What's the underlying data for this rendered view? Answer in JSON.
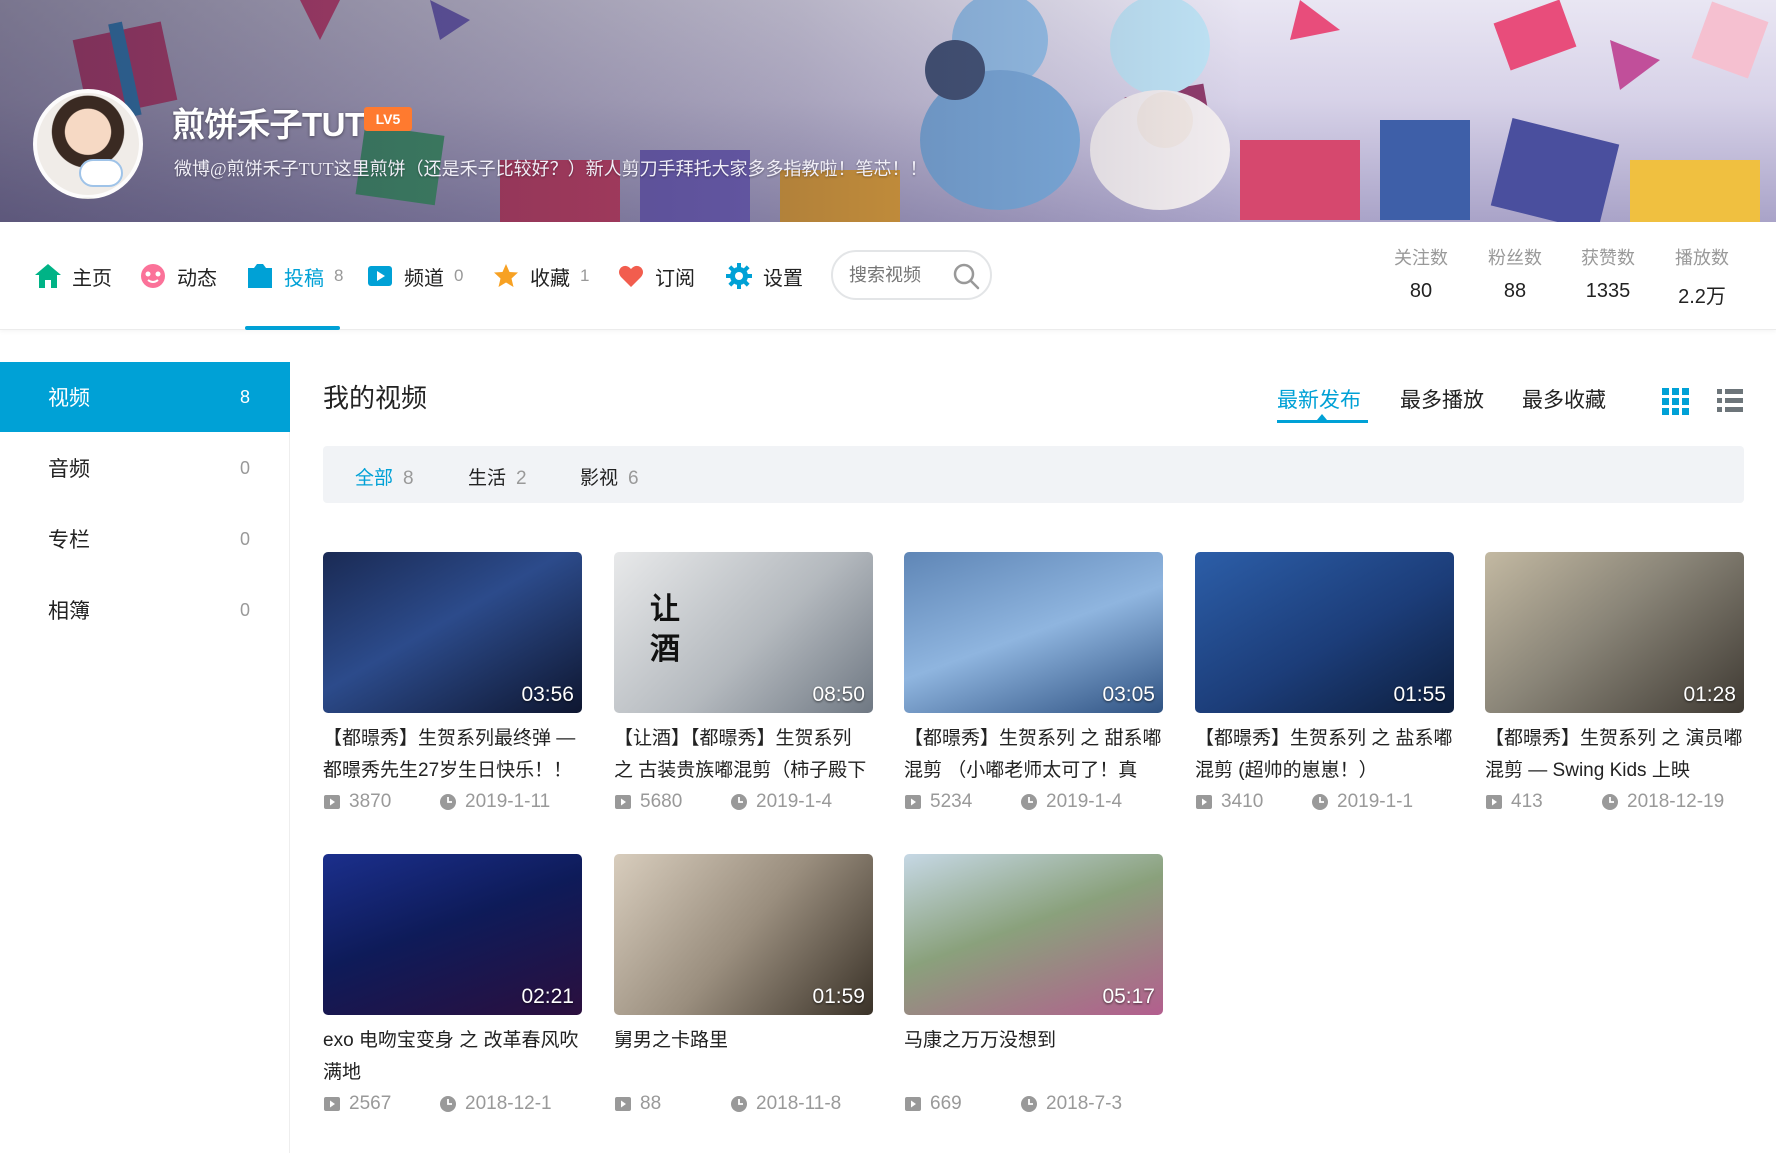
{
  "profile": {
    "username": "煎饼禾子TUT",
    "level": "LV5",
    "bio": "微博@煎饼禾子TUT这里煎饼（还是禾子比较好？）新人剪刀手拜托大家多多指教啦！笔芯！！"
  },
  "nav": {
    "items": [
      {
        "label": "主页",
        "count": "",
        "icon": "home-icon"
      },
      {
        "label": "动态",
        "count": "",
        "icon": "activity-icon"
      },
      {
        "label": "投稿",
        "count": "8",
        "icon": "upload-icon"
      },
      {
        "label": "频道",
        "count": "0",
        "icon": "channel-icon"
      },
      {
        "label": "收藏",
        "count": "1",
        "icon": "star-icon"
      },
      {
        "label": "订阅",
        "count": "",
        "icon": "heart-icon"
      },
      {
        "label": "设置",
        "count": "",
        "icon": "gear-icon"
      }
    ],
    "active_index": 2,
    "accent": "#00a1d6"
  },
  "search": {
    "placeholder": "搜索视频"
  },
  "stats": [
    {
      "label": "关注数",
      "value": "80"
    },
    {
      "label": "粉丝数",
      "value": "88"
    },
    {
      "label": "获赞数",
      "value": "1335"
    },
    {
      "label": "播放数",
      "value": "2.2万"
    }
  ],
  "sidebar": {
    "items": [
      {
        "label": "视频",
        "count": "8"
      },
      {
        "label": "音频",
        "count": "0"
      },
      {
        "label": "专栏",
        "count": "0"
      },
      {
        "label": "相簿",
        "count": "0"
      }
    ]
  },
  "main": {
    "title": "我的视频",
    "sort_tabs": [
      "最新发布",
      "最多播放",
      "最多收藏"
    ],
    "filters": [
      {
        "label": "全部",
        "count": "8"
      },
      {
        "label": "生活",
        "count": "2"
      },
      {
        "label": "影视",
        "count": "6"
      }
    ]
  },
  "videos": [
    {
      "title": "【都暻秀】生贺系列最终弹 — 都暻秀先生27岁生日快乐！！",
      "duration": "03:56",
      "plays": "3870",
      "date": "2019-1-11"
    },
    {
      "title": "【让酒】【都暻秀】生贺系列 之 古装贵族嘟混剪（柿子殿下",
      "duration": "08:50",
      "plays": "5680",
      "date": "2019-1-4",
      "thumb_text": "让\n酒"
    },
    {
      "title": "【都暻秀】生贺系列 之 甜系嘟混剪 （小嘟老师太可了！真",
      "duration": "03:05",
      "plays": "5234",
      "date": "2019-1-4"
    },
    {
      "title": "【都暻秀】生贺系列 之 盐系嘟混剪 (超帅的崽崽！）",
      "duration": "01:55",
      "plays": "3410",
      "date": "2019-1-1"
    },
    {
      "title": "【都暻秀】生贺系列 之 演员嘟混剪 — Swing Kids 上映",
      "duration": "01:28",
      "plays": "413",
      "date": "2018-12-19"
    },
    {
      "title": "exo 电吻宝变身 之 改革春风吹满地",
      "duration": "02:21",
      "plays": "2567",
      "date": "2018-12-1"
    },
    {
      "title": "舅男之卡路里",
      "duration": "01:59",
      "plays": "88",
      "date": "2018-11-8"
    },
    {
      "title": "马康之万万没想到",
      "duration": "05:17",
      "plays": "669",
      "date": "2018-7-3"
    }
  ]
}
